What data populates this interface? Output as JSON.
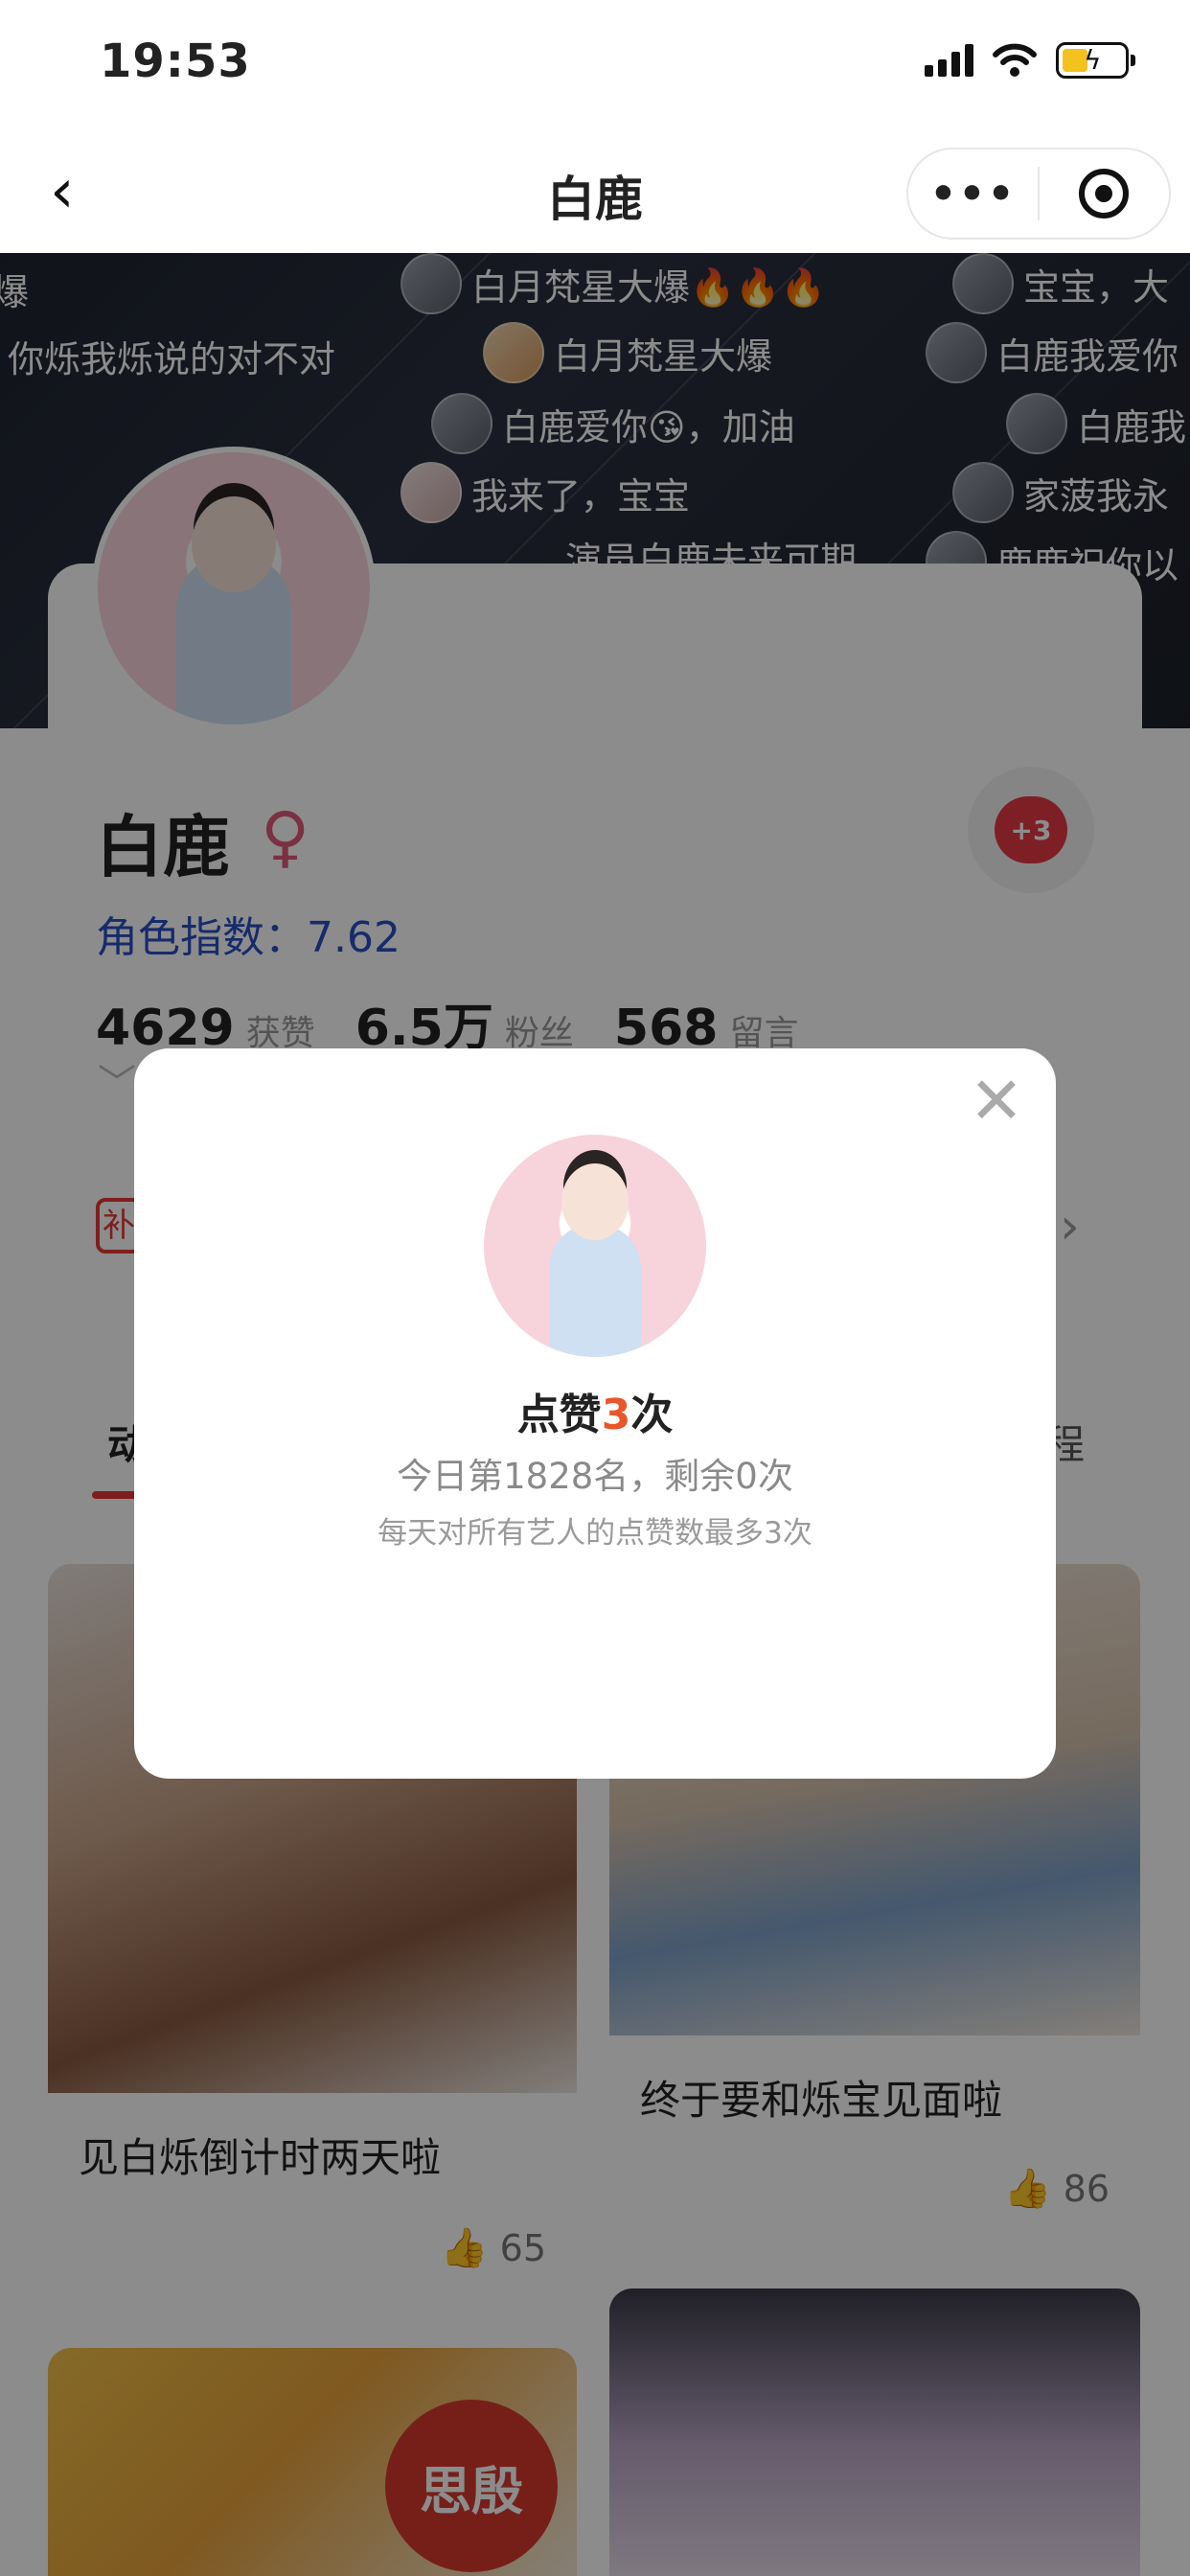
{
  "status_bar": {
    "time": "19:53"
  },
  "nav": {
    "back_icon": "‹",
    "title": "白鹿",
    "more_icon": "•••"
  },
  "danmaku": [
    {
      "text": "爆"
    },
    {
      "text": "你烁我烁说的对不对"
    },
    {
      "text": "白月梵星大爆🔥🔥🔥"
    },
    {
      "text": "宝宝，大"
    },
    {
      "text": "白月梵星大爆"
    },
    {
      "text": "白鹿我爱你"
    },
    {
      "text": "白鹿爱你😘，加油"
    },
    {
      "text": "白鹿我"
    },
    {
      "text": "我来了，宝宝"
    },
    {
      "text": "家菠我永"
    },
    {
      "text": "演员白鹿未来可期"
    },
    {
      "text": "鹿鹿祝你以"
    }
  ],
  "profile": {
    "name": "白鹿",
    "gender_icon": "♀",
    "role_index": "角色指数：7.62",
    "stats": [
      {
        "value": "4629",
        "label": "获赞"
      },
      {
        "value": "6.5万",
        "label": "粉丝"
      },
      {
        "value": "568",
        "label": "留言"
      }
    ],
    "like_badge": "+3",
    "expand_icon": "﹀"
  },
  "rowbar": {
    "tag": "补",
    "chevron": "›"
  },
  "tabs": {
    "first": "动",
    "last": "程"
  },
  "feed": [
    {
      "title": "见白烁倒计时两天啦",
      "likes": "65"
    },
    {
      "title": "终于要和烁宝见面啦",
      "likes": "86"
    },
    {
      "badge_text": "思殷"
    }
  ],
  "modal": {
    "close_icon": "✕",
    "title_prefix": "点赞",
    "title_count": "3",
    "title_suffix": "次",
    "rank_text": "今日第1828名，剩余0次",
    "hint_text": "每天对所有艺人的点赞数最多3次"
  },
  "colors": {
    "accent_red": "#e53935",
    "index_blue": "#2a4fc4",
    "count_orange": "#e8572a"
  }
}
